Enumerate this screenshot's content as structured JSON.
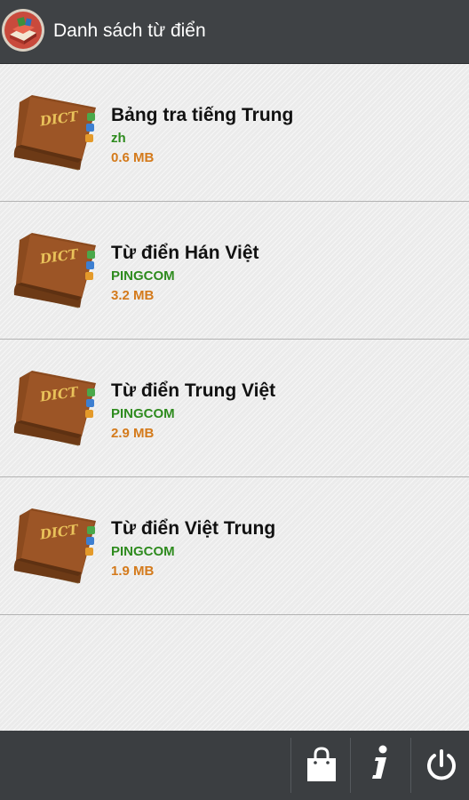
{
  "header": {
    "title": "Danh sách từ điển",
    "icon": "dictionary-app-icon"
  },
  "dictionaries": [
    {
      "name": "Bảng tra tiếng Trung",
      "author": "zh",
      "size": "0.6 MB"
    },
    {
      "name": "Từ điển Hán Việt",
      "author": "PINGCOM",
      "size": "3.2 MB"
    },
    {
      "name": "Từ điển Trung Việt",
      "author": "PINGCOM",
      "size": "2.9 MB"
    },
    {
      "name": "Từ điển Việt Trung",
      "author": "PINGCOM",
      "size": "1.9 MB"
    }
  ],
  "book_icon_text": "DICT",
  "bottom_bar": {
    "icons": [
      "shopping-bag-icon",
      "info-icon",
      "power-icon"
    ]
  },
  "colors": {
    "topbar": "#3f4245",
    "author": "#2e8b1e",
    "size": "#d47a1b",
    "bottombar": "#3b3e41"
  }
}
